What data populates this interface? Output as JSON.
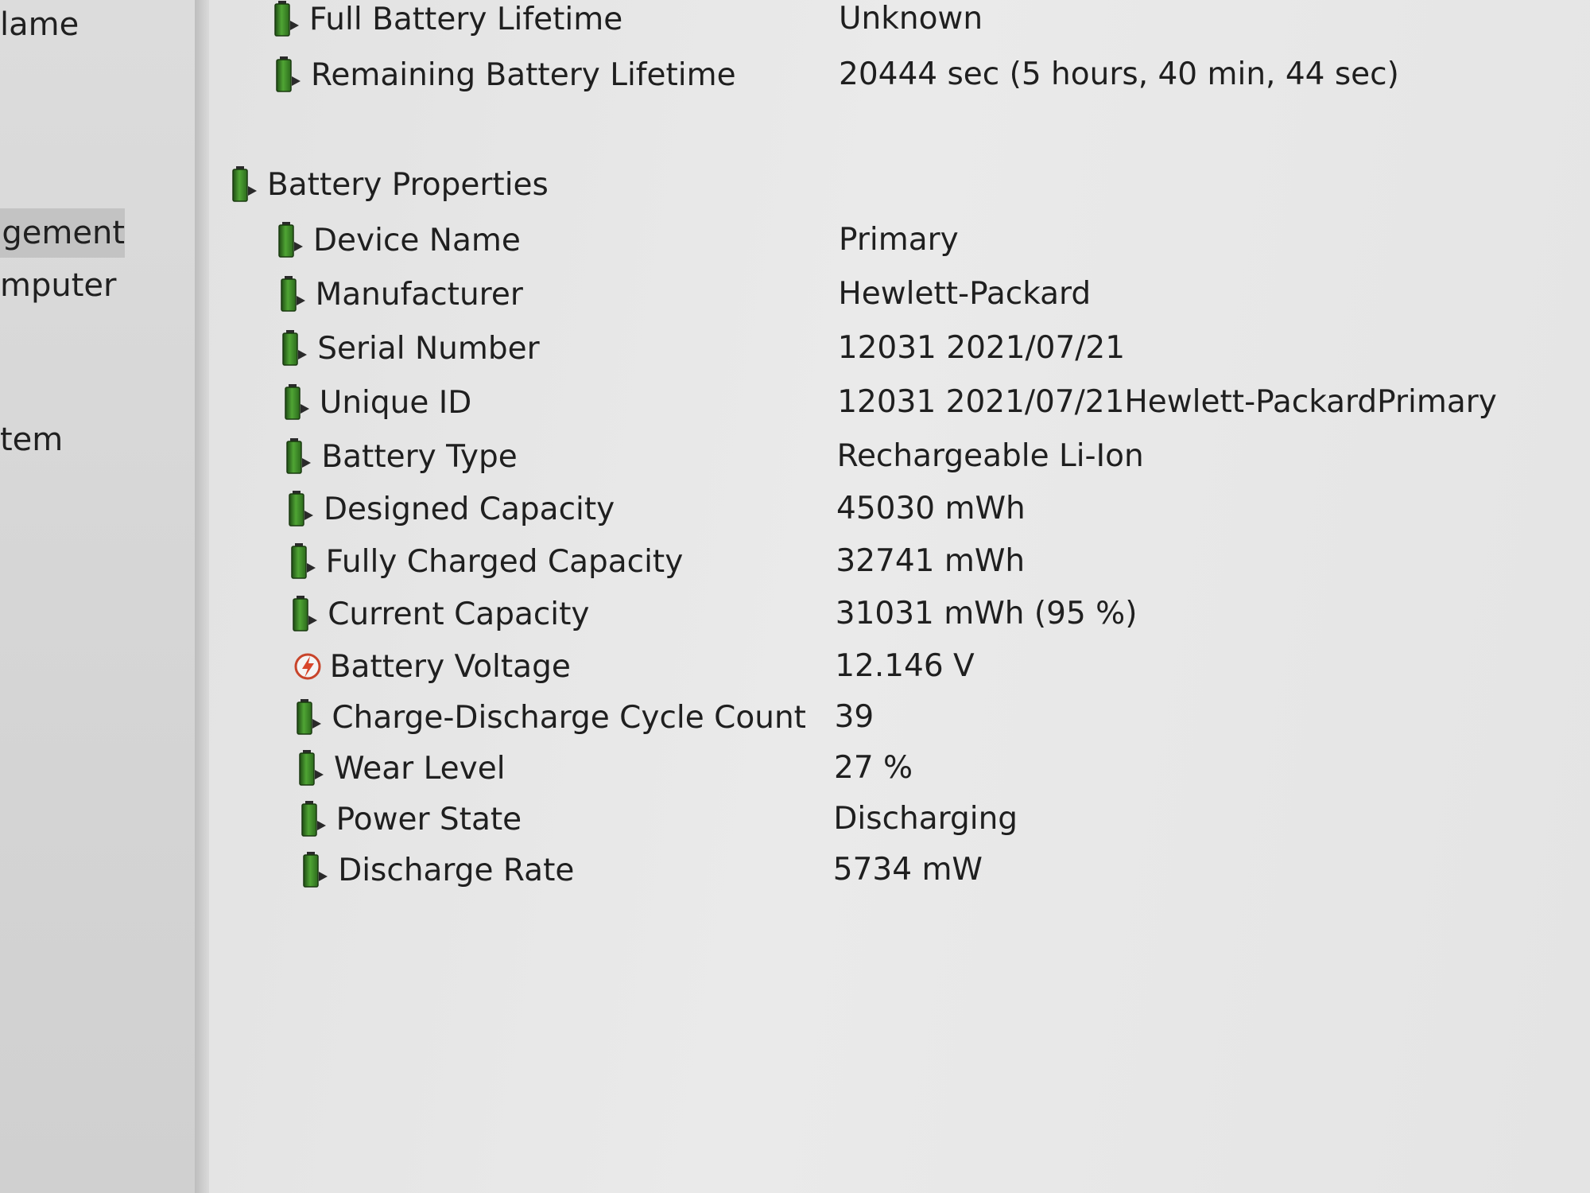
{
  "sidebar": {
    "items": [
      {
        "label": "lame",
        "selected": false
      },
      {
        "label": "agement",
        "selected": true
      },
      {
        "label": "mputer",
        "selected": false
      },
      {
        "label": "tem",
        "selected": false
      }
    ]
  },
  "lifetime": [
    {
      "label": "Full Battery Lifetime",
      "value": "Unknown",
      "icon": "battery-icon"
    },
    {
      "label": "Remaining Battery Lifetime",
      "value": "20444 sec (5 hours, 40 min, 44 sec)",
      "icon": "battery-icon"
    }
  ],
  "section": {
    "label": "Battery Properties",
    "icon": "battery-icon"
  },
  "properties": [
    {
      "label": "Device Name",
      "value": "Primary",
      "icon": "battery-icon"
    },
    {
      "label": "Manufacturer",
      "value": "Hewlett-Packard",
      "icon": "battery-icon"
    },
    {
      "label": "Serial Number",
      "value": "12031 2021/07/21",
      "icon": "battery-icon"
    },
    {
      "label": "Unique ID",
      "value": "12031 2021/07/21Hewlett-PackardPrimary",
      "icon": "battery-icon"
    },
    {
      "label": "Battery Type",
      "value": "Rechargeable Li-Ion",
      "icon": "battery-icon"
    },
    {
      "label": "Designed Capacity",
      "value": "45030 mWh",
      "icon": "battery-icon"
    },
    {
      "label": "Fully Charged Capacity",
      "value": "32741 mWh",
      "icon": "battery-icon"
    },
    {
      "label": "Current Capacity",
      "value": "31031 mWh  (95 %)",
      "icon": "battery-icon"
    },
    {
      "label": "Battery Voltage",
      "value": "12.146 V",
      "icon": "voltage-icon"
    },
    {
      "label": "Charge-Discharge Cycle Count",
      "value": "39",
      "icon": "battery-icon"
    },
    {
      "label": "Wear Level",
      "value": "27 %",
      "icon": "battery-icon"
    },
    {
      "label": "Power State",
      "value": "Discharging",
      "icon": "battery-icon"
    },
    {
      "label": "Discharge Rate",
      "value": "5734 mW",
      "icon": "battery-icon"
    }
  ],
  "colors": {
    "battery_green": "#3f8f2a",
    "battery_dark": "#1f4d14",
    "voltage_red": "#d8462b"
  }
}
